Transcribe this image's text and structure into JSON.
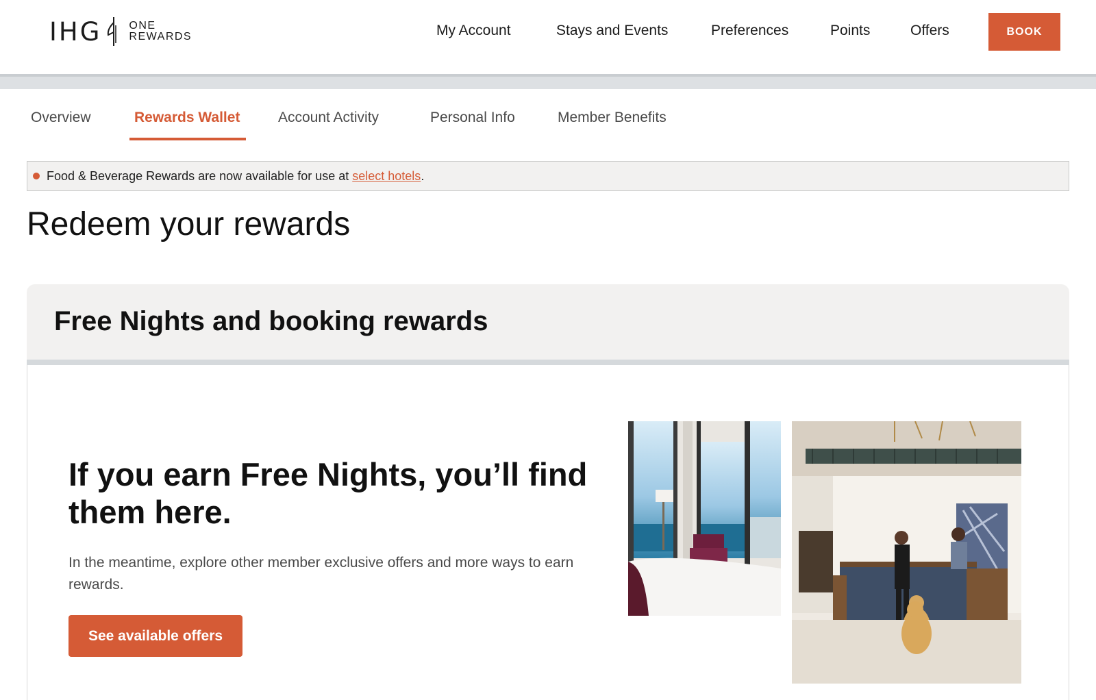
{
  "logo": {
    "brand": "IHG",
    "line1": "ONE",
    "line2": "REWARDS"
  },
  "nav": {
    "items": [
      {
        "label": "My Account"
      },
      {
        "label": "Stays and Events"
      },
      {
        "label": "Preferences"
      },
      {
        "label": "Points"
      },
      {
        "label": "Offers"
      }
    ],
    "book_label": "BOOK"
  },
  "tabs": {
    "items": [
      {
        "label": "Overview"
      },
      {
        "label": "Rewards Wallet"
      },
      {
        "label": "Account Activity"
      },
      {
        "label": "Personal Info"
      },
      {
        "label": "Member Benefits"
      }
    ],
    "active": "Rewards Wallet"
  },
  "notice": {
    "text": "Food & Beverage Rewards are now available for use at ",
    "link": "select hotels",
    "suffix": "."
  },
  "page_title": "Redeem your rewards",
  "card": {
    "title": "Free Nights and booking rewards",
    "heading": "If you earn Free Nights, you’ll find them here.",
    "body": "In the meantime, explore other member exclusive offers and more ways to earn rewards.",
    "button_label": "See available offers"
  },
  "colors": {
    "accent": "#d55b36",
    "panel": "#f2f1f0"
  }
}
